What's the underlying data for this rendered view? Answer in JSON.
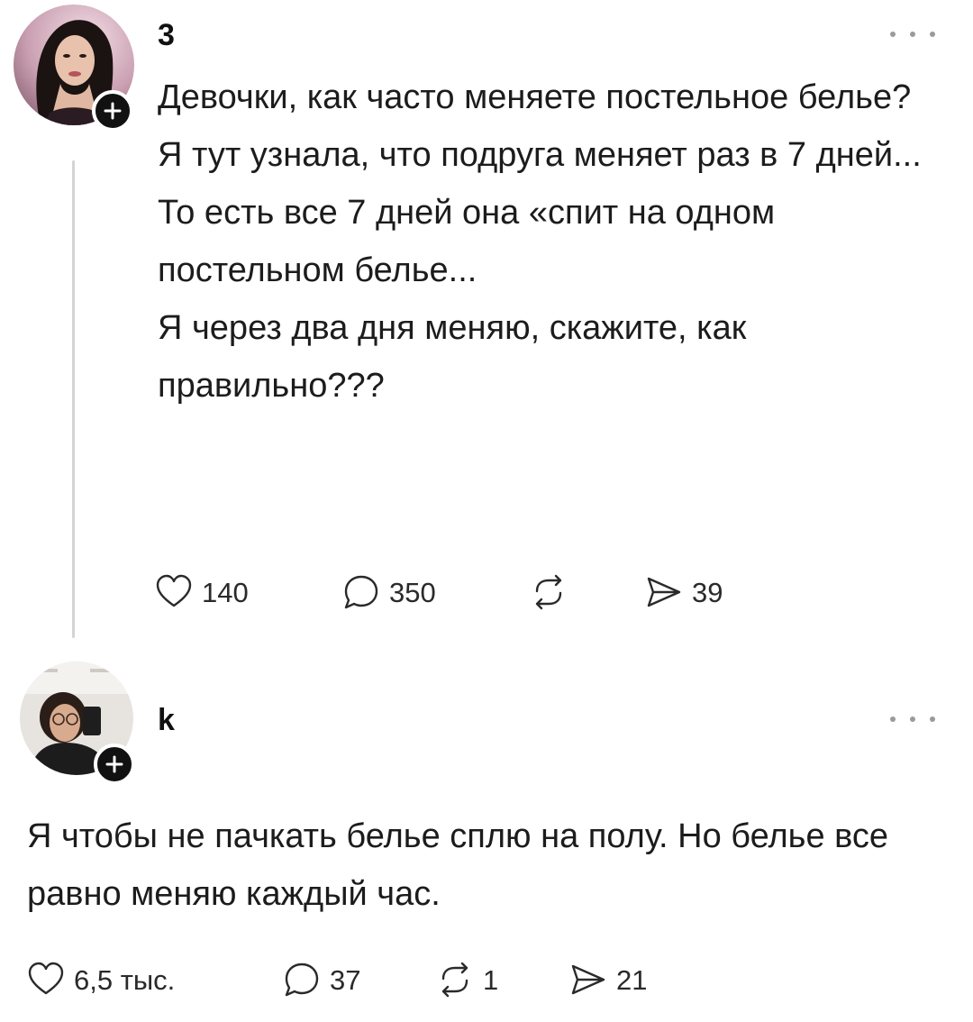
{
  "posts": [
    {
      "username": "3",
      "text": [
        "Девочки, как часто меняете постельное белье?",
        "Я тут узнала, что подруга меняет раз в 7 дней...",
        "То есть все 7 дней она «спит на одном постельном белье...",
        "Я через два дня меняю, скажите, как правильно???"
      ],
      "actions": {
        "likes": "140",
        "comments": "350",
        "reposts": "",
        "shares": "39"
      }
    },
    {
      "username": "k",
      "text": [
        "Я чтобы не пачкать белье сплю на полу. Но белье все равно меняю каждый час."
      ],
      "actions": {
        "likes": "6,5 тыс.",
        "comments": "37",
        "reposts": "1",
        "shares": "21"
      }
    }
  ],
  "icons": {
    "like": "heart-icon",
    "comment": "speech-bubble-icon",
    "repost": "repost-arrows-icon",
    "share": "send-icon",
    "more": "ellipsis-icon",
    "follow": "plus-icon"
  },
  "colors": {
    "text": "#1c1c1c",
    "icon": "#2a2a2a",
    "muted": "#9a9a9a",
    "thread_line": "#d4d4d4",
    "badge": "#111111"
  }
}
